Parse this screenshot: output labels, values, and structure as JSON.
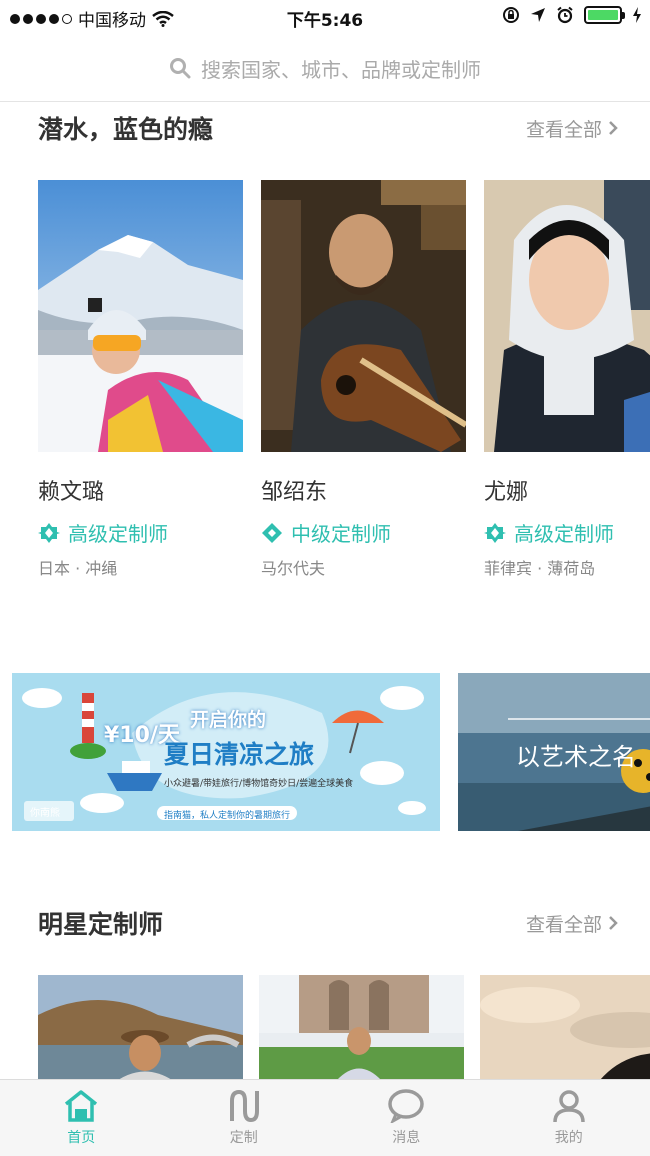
{
  "status_bar": {
    "carrier": "中国移动",
    "time": "下午5:46"
  },
  "search": {
    "placeholder": "搜索国家、城市、品牌或定制师"
  },
  "section_diving": {
    "title": "潜水，蓝色的瘾",
    "view_all": "查看全部"
  },
  "designers": [
    {
      "name": "赖文璐",
      "level": "高级定制师",
      "location": "日本 · 冲绳"
    },
    {
      "name": "邹绍东",
      "level": "中级定制师",
      "location": "马尔代夫"
    },
    {
      "name": "尤娜",
      "level": "高级定制师",
      "location": "菲律宾 · 薄荷岛"
    }
  ],
  "banners": {
    "summer": {
      "price": "¥10/天",
      "headline": "开启你的",
      "title": "夏日清凉之旅",
      "subtitle": "小众避暑/带娃旅行/博物馆奇妙日/尝遍全球美食",
      "logo": "你南熊",
      "footer": "指南猫，私人定制你的暑期旅行"
    },
    "art": {
      "title": "以艺术之名"
    }
  },
  "section_star": {
    "title": "明星定制师",
    "view_all": "查看全部"
  },
  "tabs": [
    {
      "label": "首页",
      "icon": "home-icon",
      "active": true
    },
    {
      "label": "定制",
      "icon": "custom-icon",
      "active": false
    },
    {
      "label": "消息",
      "icon": "message-icon",
      "active": false
    },
    {
      "label": "我的",
      "icon": "profile-icon",
      "active": false
    }
  ],
  "colors": {
    "accent": "#2fbfb0",
    "battery": "#4cd964"
  }
}
